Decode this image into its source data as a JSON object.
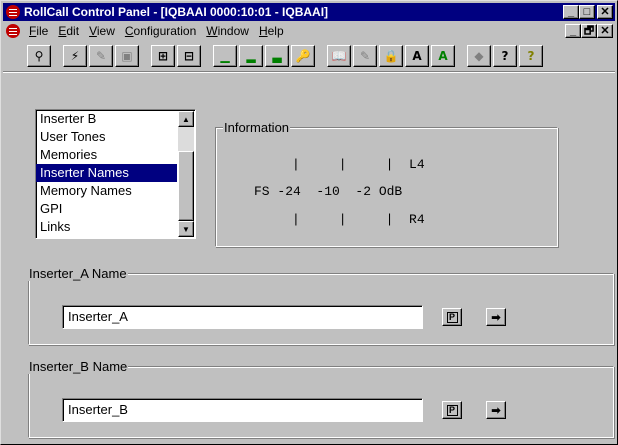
{
  "window": {
    "title": "RollCall Control Panel - [IQBAAI 0000:10:01 - IQBAAI]",
    "title_buttons": [
      "_",
      "□",
      "✕"
    ],
    "mdi_buttons": [
      "_",
      "🗗",
      "✕"
    ]
  },
  "menu": {
    "items": [
      "File",
      "Edit",
      "View",
      "Configuration",
      "Window",
      "Help"
    ],
    "underline": [
      "F",
      "E",
      "V",
      "C",
      "W",
      "H"
    ]
  },
  "toolbar": {
    "buttons": [
      {
        "name": "connect-icon",
        "glyph": "⚲"
      },
      {
        "name": "lightning-icon",
        "glyph": "⚡"
      },
      {
        "name": "edit-icon",
        "glyph": "✎"
      },
      {
        "name": "save-icon",
        "glyph": "▣"
      },
      {
        "name": "network-icon",
        "glyph": "⊞"
      },
      {
        "name": "device-icon",
        "glyph": "⊟"
      },
      {
        "name": "level-low-icon",
        "glyph": "▁"
      },
      {
        "name": "level-mid-icon",
        "glyph": "▂"
      },
      {
        "name": "level-high-icon",
        "glyph": "▃"
      },
      {
        "name": "key-icon",
        "glyph": "🔑"
      },
      {
        "name": "book-icon",
        "glyph": "📖"
      },
      {
        "name": "notes-icon",
        "glyph": "✎"
      },
      {
        "name": "lock-icon",
        "glyph": "🔒"
      },
      {
        "name": "font-a-icon",
        "glyph": "A"
      },
      {
        "name": "font-a-green-icon",
        "glyph": "A"
      },
      {
        "name": "eraser-icon",
        "glyph": "◆"
      },
      {
        "name": "help-context-icon",
        "glyph": "?"
      },
      {
        "name": "help-icon",
        "glyph": "?"
      }
    ]
  },
  "list": {
    "items": [
      "Inserter B",
      "User Tones",
      "Memories",
      "Inserter Names",
      "Memory Names",
      "GPI",
      "Links"
    ],
    "selected": "Inserter Names"
  },
  "information": {
    "label": "Information",
    "row1": "|     |     |  L4",
    "row2": "FS -24  -10  -2 OdB",
    "row3": "|     |     |  R4"
  },
  "inserter_a": {
    "label": "Inserter_A Name",
    "value": "Inserter_A",
    "p_label": "P"
  },
  "inserter_b": {
    "label": "Inserter_B Name",
    "value": "Inserter_B",
    "p_label": "P"
  },
  "colors": {
    "title_bar": "#000080",
    "face": "#c0c0c0",
    "selection": "#000080"
  }
}
